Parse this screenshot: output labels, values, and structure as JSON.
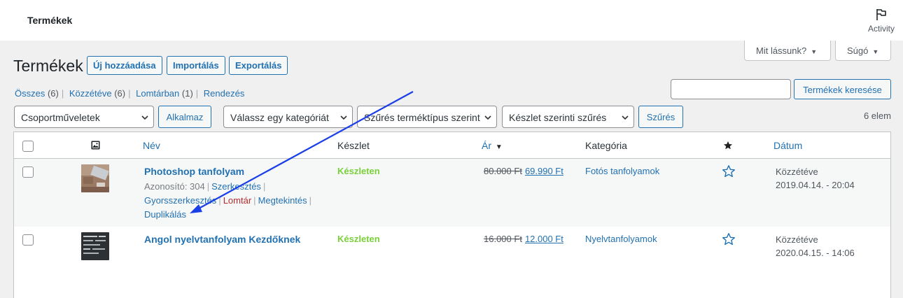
{
  "topbar": {
    "title": "Termékek",
    "activity_label": "Activity"
  },
  "screen_options": {
    "label": "Mit lássunk?",
    "help_label": "Súgó",
    "caret": "▼"
  },
  "header": {
    "title": "Termékek",
    "buttons": {
      "add_new": "Új hozzáadása",
      "import": "Importálás",
      "export": "Exportálás"
    }
  },
  "views": [
    {
      "label": "Összes",
      "count": "(6)"
    },
    {
      "label": "Közzétéve",
      "count": "(6)"
    },
    {
      "label": "Lomtárban",
      "count": "(1)"
    },
    {
      "label": "Rendezés",
      "count": ""
    }
  ],
  "views_sep": "|",
  "search": {
    "value": "",
    "button": "Termékek keresése"
  },
  "filters": {
    "bulk_actions": "Csoportműveletek",
    "apply": "Alkalmaz",
    "category": "Válassz egy kategóriát",
    "product_type": "Szűrés terméktípus szerint",
    "stock": "Készlet szerinti szűrés",
    "filter_button": "Szűrés",
    "count": "6 elem"
  },
  "columns": {
    "name": "Név",
    "stock": "Készlet",
    "price": "Ár",
    "price_sort_icon": "▼",
    "category": "Kategória",
    "date": "Dátum"
  },
  "rows": [
    {
      "name": "Photoshop tanfolyam",
      "id_label": "Azonosító: 304",
      "edit": "Szerkesztés",
      "quick_edit": "Gyorsszerkesztés",
      "trash": "Lomtár",
      "view": "Megtekintés",
      "duplicate": "Duplikálás",
      "stock": "Készleten",
      "regular_price": "80.000 Ft",
      "sale_price": "69.990 Ft",
      "category": "Fotós tanfolyamok",
      "status": "Közzétéve",
      "date": "2019.04.14. - 20:04"
    },
    {
      "name": "Angol nyelvtanfolyam Kezdőknek",
      "stock": "Készleten",
      "regular_price": "16.000 Ft",
      "sale_price": "12.000 Ft",
      "category": "Nyelvtanfolyamok",
      "status": "Közzétéve",
      "date": "2020.04.15. - 14:06"
    }
  ],
  "colors": {
    "accent": "#2271b1",
    "in_stock": "#7ad03a",
    "trash": "#b32d2e",
    "annotation_arrow": "#1a3ee8"
  }
}
